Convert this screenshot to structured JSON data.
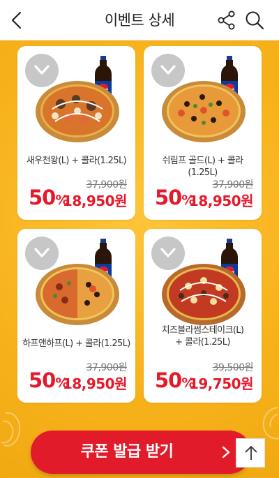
{
  "header": {
    "title": "이벤트 상세",
    "icons": [
      "back-icon",
      "share-icon",
      "search-icon"
    ]
  },
  "products": [
    {
      "name": "새우천왕(L) + 콜라(1.25L)",
      "original_price": "37,900원",
      "discount": "50",
      "discount_unit": "%",
      "price": "18,950원"
    },
    {
      "name": "쉬림프 골드(L) + 콜라(1.25L)",
      "original_price": "37,900원",
      "discount": "50",
      "discount_unit": "%",
      "price": "18,950원"
    },
    {
      "name": "하프앤하프(L) + 콜라(1.25L)",
      "original_price": "37,900원",
      "discount": "50",
      "discount_unit": "%",
      "price": "18,950원"
    },
    {
      "name_line1": "치즈블라썸스테이크(L)",
      "name_line2": "+ 콜라(1.25L)",
      "original_price": "39,500원",
      "discount": "50",
      "discount_unit": "%",
      "price": "19,750원"
    }
  ],
  "bottle_brand": "PEPSI",
  "coupon_button": {
    "label": "쿠폰 발급 받기"
  },
  "colors": {
    "accent_red": "#e11b2a",
    "background_yellow": "#f6b51d"
  }
}
